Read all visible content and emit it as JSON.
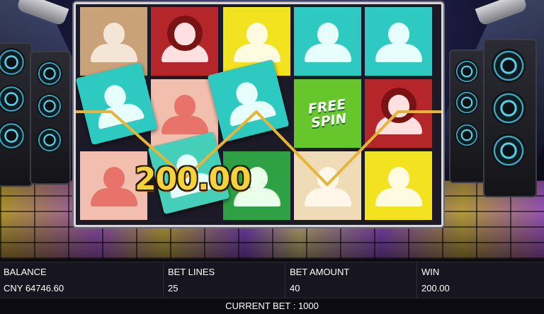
{
  "game": {
    "win_display": "200.00",
    "free_spin_text": "FREE SPIN",
    "grid_colors": {
      "tan": "#c9a27a",
      "red": "#b5262a",
      "yellow": "#f3e21f",
      "teal": "#2ec9c1",
      "pink": "#f2bfae",
      "green": "#2fa145",
      "mint": "#45cfb9",
      "beige": "#efdcb7",
      "freegreen": "#66c62c"
    },
    "payline_color": "#e7b43a"
  },
  "panel": {
    "balance_label": "BALANCE",
    "balance_value": "CNY 64746.60",
    "bet_lines_label": "BET LINES",
    "bet_lines_value": "25",
    "bet_amount_label": "BET AMOUNT",
    "bet_amount_value": "40",
    "win_label": "WIN",
    "win_value": "200.00"
  },
  "current_bet": "CURRENT BET : 1000"
}
